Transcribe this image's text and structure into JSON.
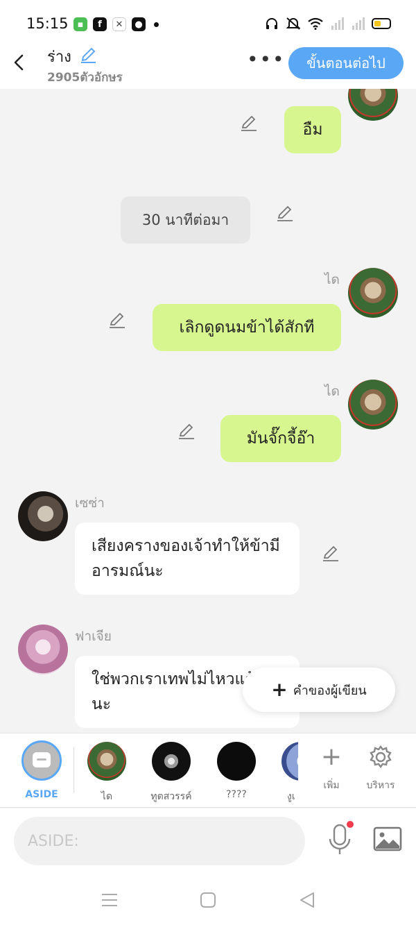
{
  "status_bar": {
    "time": "15:15",
    "app_icons": [
      "line-icon",
      "facebook-icon",
      "game-icon",
      "bear-icon"
    ],
    "system_icons": [
      "headphones-icon",
      "mute-icon",
      "wifi-icon",
      "signal-icon",
      "signal-icon",
      "battery-icon"
    ],
    "battery_color": "#f5c518"
  },
  "header": {
    "title": "ร่าง",
    "char_count": "2905ตัวอักษร",
    "more_label": "•••",
    "next_label": "ขั้นตอนต่อไป",
    "accent": "#5aa7f5"
  },
  "messages": [
    {
      "type": "right",
      "text": "อืม"
    },
    {
      "type": "narration",
      "text": "30 นาทีต่อมา"
    },
    {
      "type": "right",
      "speaker": "ได",
      "text": "เลิกดูดนมข้าได้สักที"
    },
    {
      "type": "right",
      "speaker": "ได",
      "text": "มันจั๊กจี้อ๊า"
    },
    {
      "type": "left",
      "speaker": "เซซ่า",
      "text": "เสียงครางของเจ้าทำให้ข้ามีอารมณ์นะ"
    },
    {
      "type": "left",
      "speaker": "ฟาเจีย",
      "text": "ใช่พวกเราเทพไม่ไหวแล้วนะ"
    }
  ],
  "author_button": {
    "label": "คำของผู้เขียน"
  },
  "characters": [
    {
      "label": "ASIDE",
      "selected": true
    },
    {
      "label": "ได"
    },
    {
      "label": "ทูตสวรรค์"
    },
    {
      "label": "????"
    },
    {
      "label": "งูเ"
    }
  ],
  "tools": [
    {
      "label": "เพิ่ม",
      "icon": "plus-icon"
    },
    {
      "label": "บริหาร",
      "icon": "gear-icon"
    }
  ],
  "input": {
    "placeholder": "ASIDE:",
    "mic_badge_color": "#f23b4d"
  },
  "nav": [
    "menu-icon",
    "home-icon",
    "back-icon"
  ]
}
